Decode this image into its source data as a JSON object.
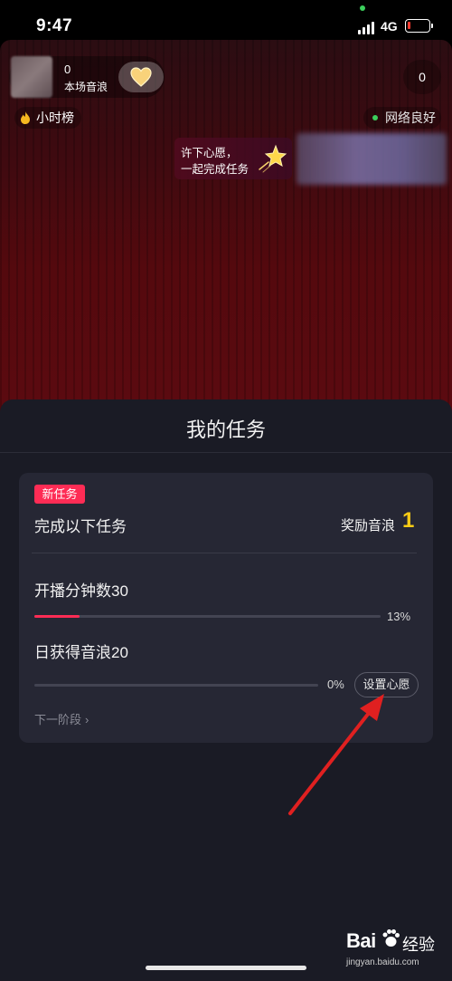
{
  "status_bar": {
    "time": "9:47",
    "network": "4G",
    "battery_level": 0.1,
    "battery_color": "#ff3b30"
  },
  "live_room": {
    "host": {
      "count": "0",
      "label": "本场音浪"
    },
    "viewer_count": "0",
    "hour_rank": "小时榜",
    "network_status": "网络良好",
    "wish_banner": {
      "line1": "许下心愿，",
      "line2": "一起完成任务"
    }
  },
  "task_sheet": {
    "title": "我的任务",
    "card": {
      "badge": "新任务",
      "heading": "完成以下任务",
      "reward_label": "奖励音浪",
      "reward_value": "1",
      "tasks": [
        {
          "label": "开播分钟数30",
          "progress": 0.13,
          "percent_text": "13%"
        },
        {
          "label": "日获得音浪20",
          "progress": 0.0,
          "percent_text": "0%"
        }
      ],
      "set_wish_button": "设置心愿",
      "next_stage": "下一阶段"
    }
  },
  "watermark": {
    "logo": "Bai",
    "logo_suffix": "经验",
    "url": "jingyan.baidu.com"
  },
  "colors": {
    "accent": "#fe2c55",
    "reward": "#facc15",
    "sheet_bg": "#1a1b25",
    "card_bg": "#262734",
    "annotation": "#e02020"
  },
  "icons": [
    "signal-icon",
    "battery-icon",
    "heart-icon",
    "flame-icon",
    "green-dot-icon",
    "star-icon",
    "chevron-right-icon",
    "paw-icon"
  ]
}
